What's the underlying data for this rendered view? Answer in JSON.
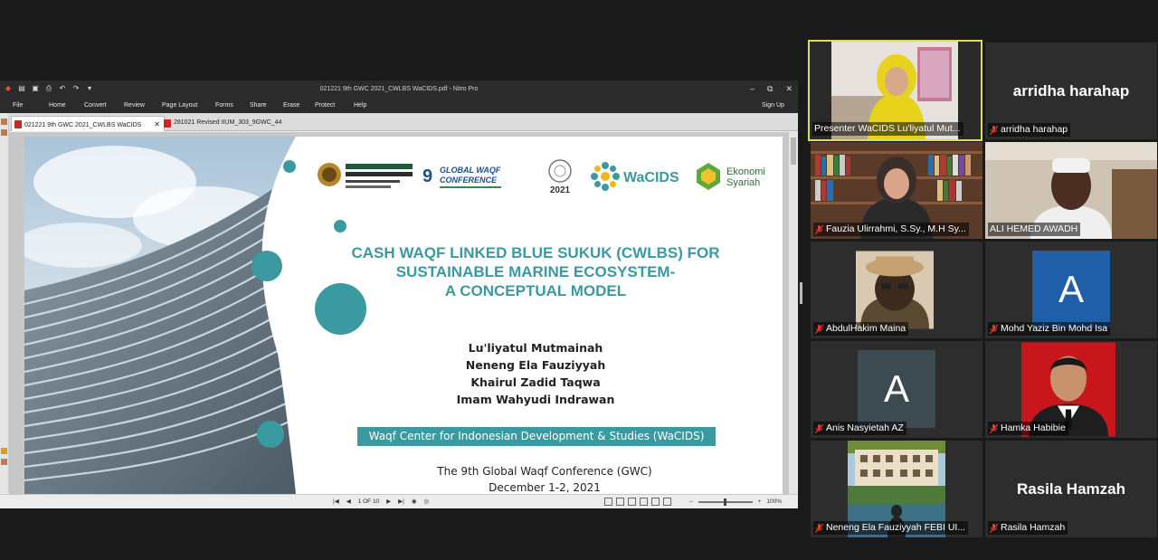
{
  "window": {
    "title": "021221 9th GWC 2021_CWLBS WaCIDS.pdf - Nitro Pro",
    "controls": [
      "–",
      "⧉",
      "✕"
    ]
  },
  "menu": [
    "File",
    "Home",
    "Convert",
    "Review",
    "Page Layout",
    "Forms",
    "Share",
    "Erase",
    "Protect",
    "Help"
  ],
  "sign_up": "Sign Up",
  "tabs": [
    {
      "label": "021221 9th GWC 2021_CWLBS WaCIDS",
      "close": "✕"
    },
    {
      "label": "281021 Revised IIUM_303_9GWC_44"
    }
  ],
  "slide": {
    "logo_gwc_number": "9",
    "logo_gwc_line1": "GLOBAL WAQF",
    "logo_gwc_line2": "CONFERENCE",
    "logo_year": "2021",
    "logo_wacids": "WaCIDS",
    "logo_ekonomi_1": "Ekonomi",
    "logo_ekonomi_2": "Syariah",
    "title_lines": [
      "CASH WAQF LINKED BLUE SUKUK (CWLBS) FOR",
      "SUSTAINABLE MARINE ECOSYSTEM-",
      "A CONCEPTUAL MODEL"
    ],
    "authors": [
      "Lu'liyatul Mutmainah",
      "Neneng Ela Fauziyyah",
      "Khairul Zadid Taqwa",
      "Imam Wahyudi Indrawan"
    ],
    "institution": "Waqf Center for Indonesian Development & Studies (WaCIDS)",
    "conference_line1": "The 9th Global Waqf Conference (GWC)",
    "conference_line2": "December 1-2, 2021",
    "accent_color": "#3a9aa0"
  },
  "status": {
    "page_indicator": "1 OF 10",
    "zoom": "100%"
  },
  "participants": [
    {
      "name": "Presenter WaCIDS Lu'liyatul Mut...",
      "type": "video",
      "active": true,
      "muted": false
    },
    {
      "name": "arridha harahap",
      "display": "arridha harahap",
      "type": "name",
      "muted": true
    },
    {
      "name": "Fauzia Ulirrahmi, S.Sy., M.H Sy...",
      "type": "video",
      "muted": true
    },
    {
      "name": "ALI HEMED AWADH",
      "type": "video",
      "muted": false
    },
    {
      "name": "AbdulHakim Maina",
      "type": "video",
      "muted": true
    },
    {
      "name": "Mohd Yaziz Bin Mohd Isa",
      "type": "avatar",
      "letter": "A",
      "color": "#1f5fa8",
      "muted": true
    },
    {
      "name": "Anis Nasyietah AZ",
      "type": "avatar",
      "letter": "A",
      "color": "#3d4a52",
      "muted": true
    },
    {
      "name": "Hamka Habibie",
      "type": "video",
      "muted": true
    },
    {
      "name": "Neneng Ela Fauziyyah FEBI UI...",
      "type": "video",
      "muted": true
    },
    {
      "name": "Rasila Hamzah",
      "display": "Rasila Hamzah",
      "type": "name",
      "muted": true
    }
  ]
}
